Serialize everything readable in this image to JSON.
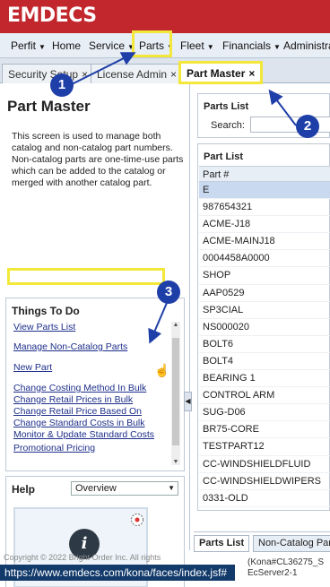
{
  "app": {
    "logo": "EMDECS"
  },
  "nav": {
    "items": [
      {
        "label": "Perfit",
        "caret": "▼"
      },
      {
        "label": "Home",
        "caret": ""
      },
      {
        "label": "Service",
        "caret": "▼"
      },
      {
        "label": "Parts",
        "caret": "▼"
      },
      {
        "label": "Fleet",
        "caret": "▼"
      },
      {
        "label": "Financials",
        "caret": "▼"
      },
      {
        "label": "Administra",
        "caret": ""
      }
    ]
  },
  "tabs": [
    {
      "label": "Security Setup",
      "close": "×"
    },
    {
      "label": "License Admin",
      "close": "×"
    },
    {
      "label": "Part Master",
      "close": "×"
    }
  ],
  "left": {
    "title": "Part Master",
    "description": "This screen is used to manage both catalog and non-catalog part numbers. Non-catalog parts are one-time-use parts which can be added to the catalog or merged with another catalog part.",
    "todo": {
      "title": "Things To Do",
      "items": [
        "View Parts List",
        "Manage Non-Catalog Parts",
        "New Part",
        "Change Costing Method In Bulk",
        "Change Retail Prices in Bulk",
        "Change Retail Price Based On",
        "Change Standard Costs in Bulk",
        "Monitor & Update Standard Costs",
        "Promotional Pricing"
      ]
    },
    "help": {
      "title": "Help",
      "selected": "Overview"
    }
  },
  "right": {
    "search": {
      "title": "Parts List",
      "label": "Search:",
      "value": ""
    },
    "list": {
      "title": "Part List",
      "column": "Part #",
      "rows": [
        "E",
        "987654321",
        "ACME-J18",
        "ACME-MAINJ18",
        "0004458A0000",
        "SHOP",
        "AAP0529",
        "SP3CIAL",
        "NS000020",
        "BOLT6",
        "BOLT4",
        "BEARING 1",
        "CONTROL ARM",
        "SUG-D06",
        "BR75-CORE",
        "TESTPART12",
        "CC-WINDSHIELDFLUID",
        "CC-WINDSHIELDWIPERS",
        "0331-OLD"
      ]
    },
    "bottom_tabs": [
      "Parts List",
      "Non-Catalog Par"
    ]
  },
  "footer": {
    "copyright": "Copyright © 2022 Bright Order Inc. All rights",
    "url": "https://www.emdecs.com/kona/faces/index.jsf#",
    "server_line1": "(Kona#CL36275_S",
    "server_line2": "EcServer2-1"
  },
  "annotations": {
    "one": "1",
    "two": "2",
    "three": "3"
  },
  "colors": {
    "brand_red": "#c1272d",
    "highlight_yellow": "#f3e83a",
    "callout_blue": "#1f3fa8",
    "status_bar": "#123a6a"
  }
}
